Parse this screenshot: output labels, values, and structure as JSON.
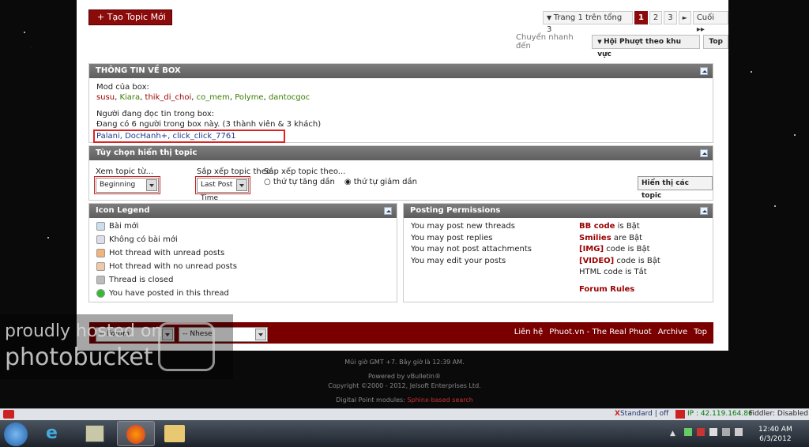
{
  "actions": {
    "new_topic": "Tạo Topic Mới"
  },
  "pagination": {
    "label": "Trang 1 trên tổng 3",
    "pages": [
      "1",
      "2",
      "3"
    ],
    "next": "►",
    "last": "Cuối ▸▸"
  },
  "quick_nav": {
    "label": "Chuyển nhanh đến",
    "forum_select": "Hội Phượt theo khu vực",
    "top": "Top"
  },
  "box_info": {
    "title": "THÔNG TIN VỀ BOX",
    "mods_label": "Mod của box:",
    "mods": [
      "susu",
      "Kiara",
      "thik_di_choi",
      "co_mem",
      "Polyme",
      "dantocgoc"
    ],
    "readers_label": "Người đang đọc tin trong box:",
    "readers_count": "Đang có 6 người trong box này. (3 thành viên & 3 khách)",
    "readers": "Palani, DocHanh+, click_click_7761"
  },
  "display_options": {
    "title": "Tùy chọn hiển thị topic",
    "from_label": "Xem topic từ...",
    "from_value": "Beginning",
    "sort_label": "Sắp xếp topic theo:",
    "sort_value": "Last Post Time",
    "order_label": "Sắp xếp topic theo...",
    "asc": "thứ tự tăng dần",
    "desc": "thứ tự giảm dần",
    "submit": "Hiển thị các topic"
  },
  "legend": {
    "title": "Icon Legend",
    "items": [
      "Bài mới",
      "Không có bài mới",
      "Hot thread with unread posts",
      "Hot thread with no unread posts",
      "Thread is closed",
      "You have posted in this thread"
    ]
  },
  "permissions": {
    "title": "Posting Permissions",
    "left": [
      "You may post new threads",
      "You may post replies",
      "You may not post attachments",
      "You may edit your posts"
    ],
    "right": [
      {
        "b": "BB code",
        "t": " is Bật"
      },
      {
        "b": "Smilies",
        "t": " are Bật"
      },
      {
        "b": "[IMG]",
        "t": " code is Bật"
      },
      {
        "b": "[VIDEO]",
        "t": " code is Bật"
      },
      {
        "b": "",
        "t": "HTML code is Tắt"
      }
    ],
    "rules": "Forum Rules"
  },
  "footer": {
    "style_select": "-- Forum",
    "lang_select": "-- Nhese",
    "links": [
      "Liên hệ",
      "Phuot.vn - The Real Phuot",
      "Archive",
      "Top"
    ],
    "timezone": "Múi giờ GMT +7. Bây giờ là 12:39 AM.",
    "powered": "Powered by vBulletin®",
    "copyright": "Copyright ©2000 - 2012, Jelsoft Enterprises Ltd.",
    "dp_label": "Digital Point modules:",
    "dp_value": "Sphinx-based search"
  },
  "watermark": {
    "line1": "proudly hosted on",
    "line2": "photobucket"
  },
  "statusbar": {
    "standard": "Standard | off",
    "ip": "IP : 42.119.164.86",
    "fiddler": "Fiddler: Disabled"
  },
  "clock": {
    "time": "12:40 AM",
    "date": "6/3/2012"
  }
}
